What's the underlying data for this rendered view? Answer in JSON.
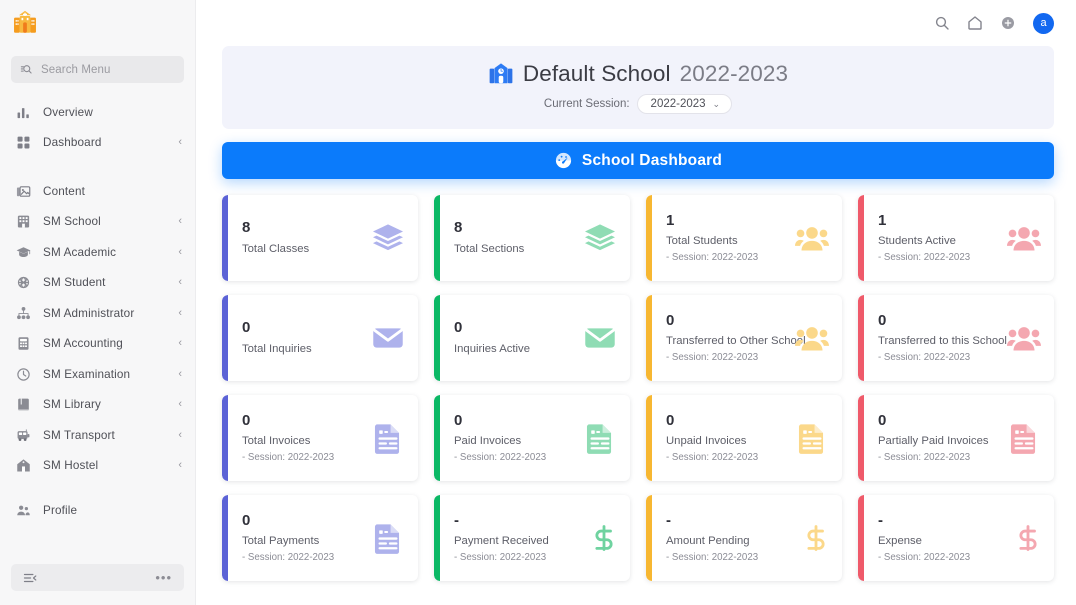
{
  "colors": {
    "accent_blue": "#0b7bfb",
    "sidebar_bg": "#f7f7f8",
    "banner_bg": "#f2f3fb",
    "card_purple": "#5b62d6",
    "card_green": "#0bb865",
    "card_yellow": "#f7b731",
    "card_red": "#ef5a6a",
    "icon_purple": "#aeb2ec",
    "icon_green": "#8fdcb4",
    "icon_yellow": "#fbd88a",
    "icon_red": "#f4a7b0",
    "logo_orange": "#f5a623"
  },
  "sidebar": {
    "logo_name": "school-logo-icon",
    "search": {
      "placeholder": "Search Menu",
      "icon": "search-menu-icon"
    },
    "items": [
      {
        "label": "Overview",
        "icon": "bar-chart-icon",
        "chevron": ""
      },
      {
        "label": "Dashboard",
        "icon": "grid-icon",
        "chevron": "‹"
      },
      {
        "label": "Content",
        "icon": "images-icon",
        "chevron": ""
      },
      {
        "label": "SM School",
        "icon": "building-icon",
        "chevron": "‹"
      },
      {
        "label": "SM Academic",
        "icon": "graduation-icon",
        "chevron": "‹"
      },
      {
        "label": "SM Student",
        "icon": "student-icon",
        "chevron": "‹"
      },
      {
        "label": "SM Administrator",
        "icon": "admin-icon",
        "chevron": "‹"
      },
      {
        "label": "SM Accounting",
        "icon": "accounting-icon",
        "chevron": "‹"
      },
      {
        "label": "SM Examination",
        "icon": "clock-icon",
        "chevron": "‹"
      },
      {
        "label": "SM Library",
        "icon": "book-icon",
        "chevron": "‹"
      },
      {
        "label": "SM Transport",
        "icon": "bus-icon",
        "chevron": "‹"
      },
      {
        "label": "SM Hostel",
        "icon": "home-icon",
        "chevron": "‹"
      },
      {
        "label": "Profile",
        "icon": "profile-icon",
        "chevron": ""
      }
    ],
    "footer": {
      "collapse_icon": "collapse-menu-icon",
      "more_label": "•••"
    }
  },
  "topbar": {
    "search_icon": "search-icon",
    "home_icon": "home-icon",
    "add_icon": "plus-circle-icon",
    "avatar_label": "a"
  },
  "school_header": {
    "icon": "school-building-icon",
    "name": "Default School",
    "year": "2022-2023",
    "session_label": "Current Session:",
    "session_value": "2022-2023",
    "chevron": "⌄"
  },
  "dashboard_bar": {
    "label": "School Dashboard",
    "icon": "gauge-icon"
  },
  "cards": [
    {
      "value": "8",
      "label": "Total Classes",
      "sub": "",
      "color": "#5b62d6",
      "icon": "layers-icon",
      "icon_color": "#aeb2ec"
    },
    {
      "value": "8",
      "label": "Total Sections",
      "sub": "",
      "color": "#0bb865",
      "icon": "layers-icon",
      "icon_color": "#8fdcb4"
    },
    {
      "value": "1",
      "label": "Total Students",
      "sub": "- Session: 2022-2023",
      "color": "#f7b731",
      "icon": "users-icon",
      "icon_color": "#fbd88a"
    },
    {
      "value": "1",
      "label": "Students Active",
      "sub": "- Session: 2022-2023",
      "color": "#ef5a6a",
      "icon": "users-icon",
      "icon_color": "#f4a7b0"
    },
    {
      "value": "0",
      "label": "Total Inquiries",
      "sub": "",
      "color": "#5b62d6",
      "icon": "envelope-icon",
      "icon_color": "#aeb2ec"
    },
    {
      "value": "0",
      "label": "Inquiries Active",
      "sub": "",
      "color": "#0bb865",
      "icon": "envelope-icon",
      "icon_color": "#8fdcb4"
    },
    {
      "value": "0",
      "label": "Transferred to Other School",
      "sub": "- Session: 2022-2023",
      "color": "#f7b731",
      "icon": "users-icon",
      "icon_color": "#fbd88a"
    },
    {
      "value": "0",
      "label": "Transferred to this School",
      "sub": "- Session: 2022-2023",
      "color": "#ef5a6a",
      "icon": "users-icon",
      "icon_color": "#f4a7b0"
    },
    {
      "value": "0",
      "label": "Total Invoices",
      "sub": "- Session: 2022-2023",
      "color": "#5b62d6",
      "icon": "invoice-icon",
      "icon_color": "#aeb2ec"
    },
    {
      "value": "0",
      "label": "Paid Invoices",
      "sub": "- Session: 2022-2023",
      "color": "#0bb865",
      "icon": "invoice-icon",
      "icon_color": "#8fdcb4"
    },
    {
      "value": "0",
      "label": "Unpaid Invoices",
      "sub": "- Session: 2022-2023",
      "color": "#f7b731",
      "icon": "invoice-icon",
      "icon_color": "#fbd88a"
    },
    {
      "value": "0",
      "label": "Partially Paid Invoices",
      "sub": "- Session: 2022-2023",
      "color": "#ef5a6a",
      "icon": "invoice-icon",
      "icon_color": "#f4a7b0"
    },
    {
      "value": "0",
      "label": "Total Payments",
      "sub": "- Session: 2022-2023",
      "color": "#5b62d6",
      "icon": "invoice-icon",
      "icon_color": "#aeb2ec"
    },
    {
      "value": "-",
      "label": "Payment Received",
      "sub": "- Session: 2022-2023",
      "color": "#0bb865",
      "icon": "dollar-icon",
      "icon_color": "#6fd3a0"
    },
    {
      "value": "-",
      "label": "Amount Pending",
      "sub": "- Session: 2022-2023",
      "color": "#f7b731",
      "icon": "dollar-icon",
      "icon_color": "#fbd88a"
    },
    {
      "value": "-",
      "label": "Expense",
      "sub": "- Session: 2022-2023",
      "color": "#ef5a6a",
      "icon": "dollar-icon",
      "icon_color": "#f4a7b0"
    }
  ]
}
